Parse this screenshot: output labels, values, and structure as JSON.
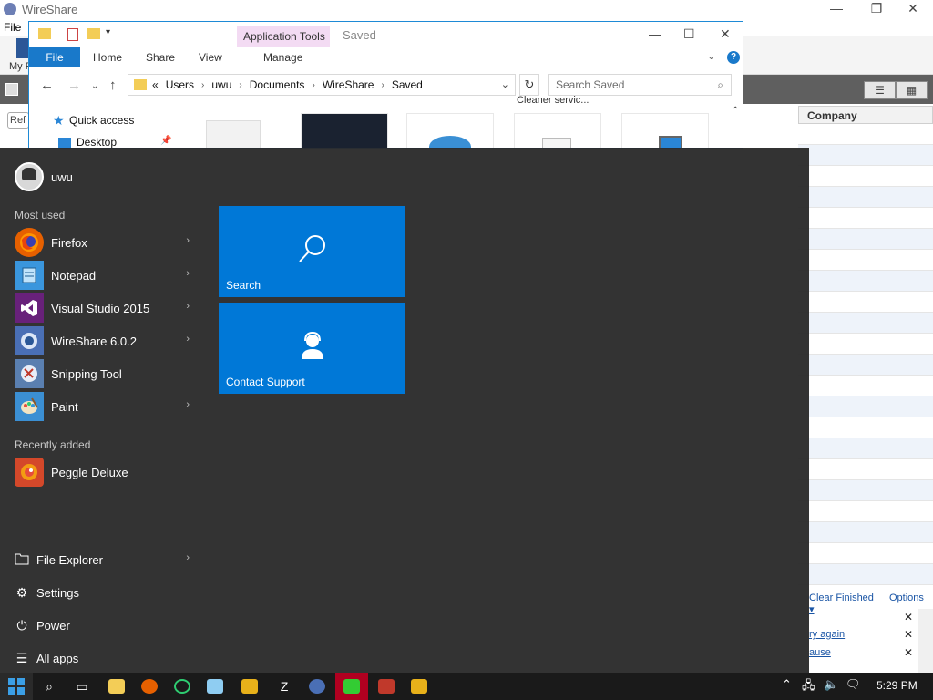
{
  "wireshare": {
    "title": "WireShare",
    "menu_file": "File",
    "my_library": "My F",
    "column_company": "Company",
    "link_clear_finished": "Clear Finished",
    "link_options": "Options ▾",
    "msg_try_again": "ry again",
    "msg_pause": "ause",
    "refresh_partial": "Ref"
  },
  "explorer": {
    "app_tools": "Application Tools",
    "window_title": "Saved",
    "tabs": {
      "file": "File",
      "home": "Home",
      "share": "Share",
      "view": "View",
      "manage": "Manage"
    },
    "breadcrumb": [
      "«",
      "Users",
      "uwu",
      "Documents",
      "WireShare",
      "Saved"
    ],
    "search_placeholder": "Search Saved",
    "nav": {
      "quick_access": "Quick access",
      "desktop": "Desktop"
    },
    "partial_file_labels": "Cleaner  servic..."
  },
  "start_menu": {
    "username": "uwu",
    "most_used_label": "Most used",
    "most_used": [
      {
        "label": "Firefox",
        "icon": "firefox-icon",
        "color": "#e66000",
        "has_arrow": true
      },
      {
        "label": "Notepad",
        "icon": "notepad-icon",
        "color": "#3a96dd",
        "has_arrow": true
      },
      {
        "label": "Visual Studio 2015",
        "icon": "visual-studio-icon",
        "color": "#68217a",
        "has_arrow": true
      },
      {
        "label": "WireShare 6.0.2",
        "icon": "wireshare-icon",
        "color": "#4a6fb5",
        "has_arrow": true
      },
      {
        "label": "Snipping Tool",
        "icon": "snipping-tool-icon",
        "color": "#5a7fb0",
        "has_arrow": false
      },
      {
        "label": "Paint",
        "icon": "paint-icon",
        "color": "#3b8fd3",
        "has_arrow": true
      }
    ],
    "recently_added_label": "Recently added",
    "recently_added": [
      {
        "label": "Peggle Deluxe",
        "icon": "peggle-icon",
        "color": "#d4482a"
      }
    ],
    "system": [
      {
        "label": "File Explorer",
        "icon": "folder-icon",
        "has_arrow": true
      },
      {
        "label": "Settings",
        "icon": "gear-icon",
        "has_arrow": false
      },
      {
        "label": "Power",
        "icon": "power-icon",
        "has_arrow": false
      },
      {
        "label": "All apps",
        "icon": "list-icon",
        "has_arrow": false
      }
    ],
    "tiles": [
      {
        "label": "Search",
        "icon": "search-icon"
      },
      {
        "label": "Contact Support",
        "icon": "contact-support-icon"
      }
    ],
    "tile_color": "#0078d7"
  },
  "taskbar": {
    "time": "5:29 PM",
    "pinned": [
      "file-explorer-icon",
      "firefox-icon",
      "opera-icon",
      "notepad-icon",
      "fl-studio-icon",
      "z-icon",
      "wireshare-icon",
      "app-icon",
      "vs-icon",
      "paint-icon"
    ]
  }
}
